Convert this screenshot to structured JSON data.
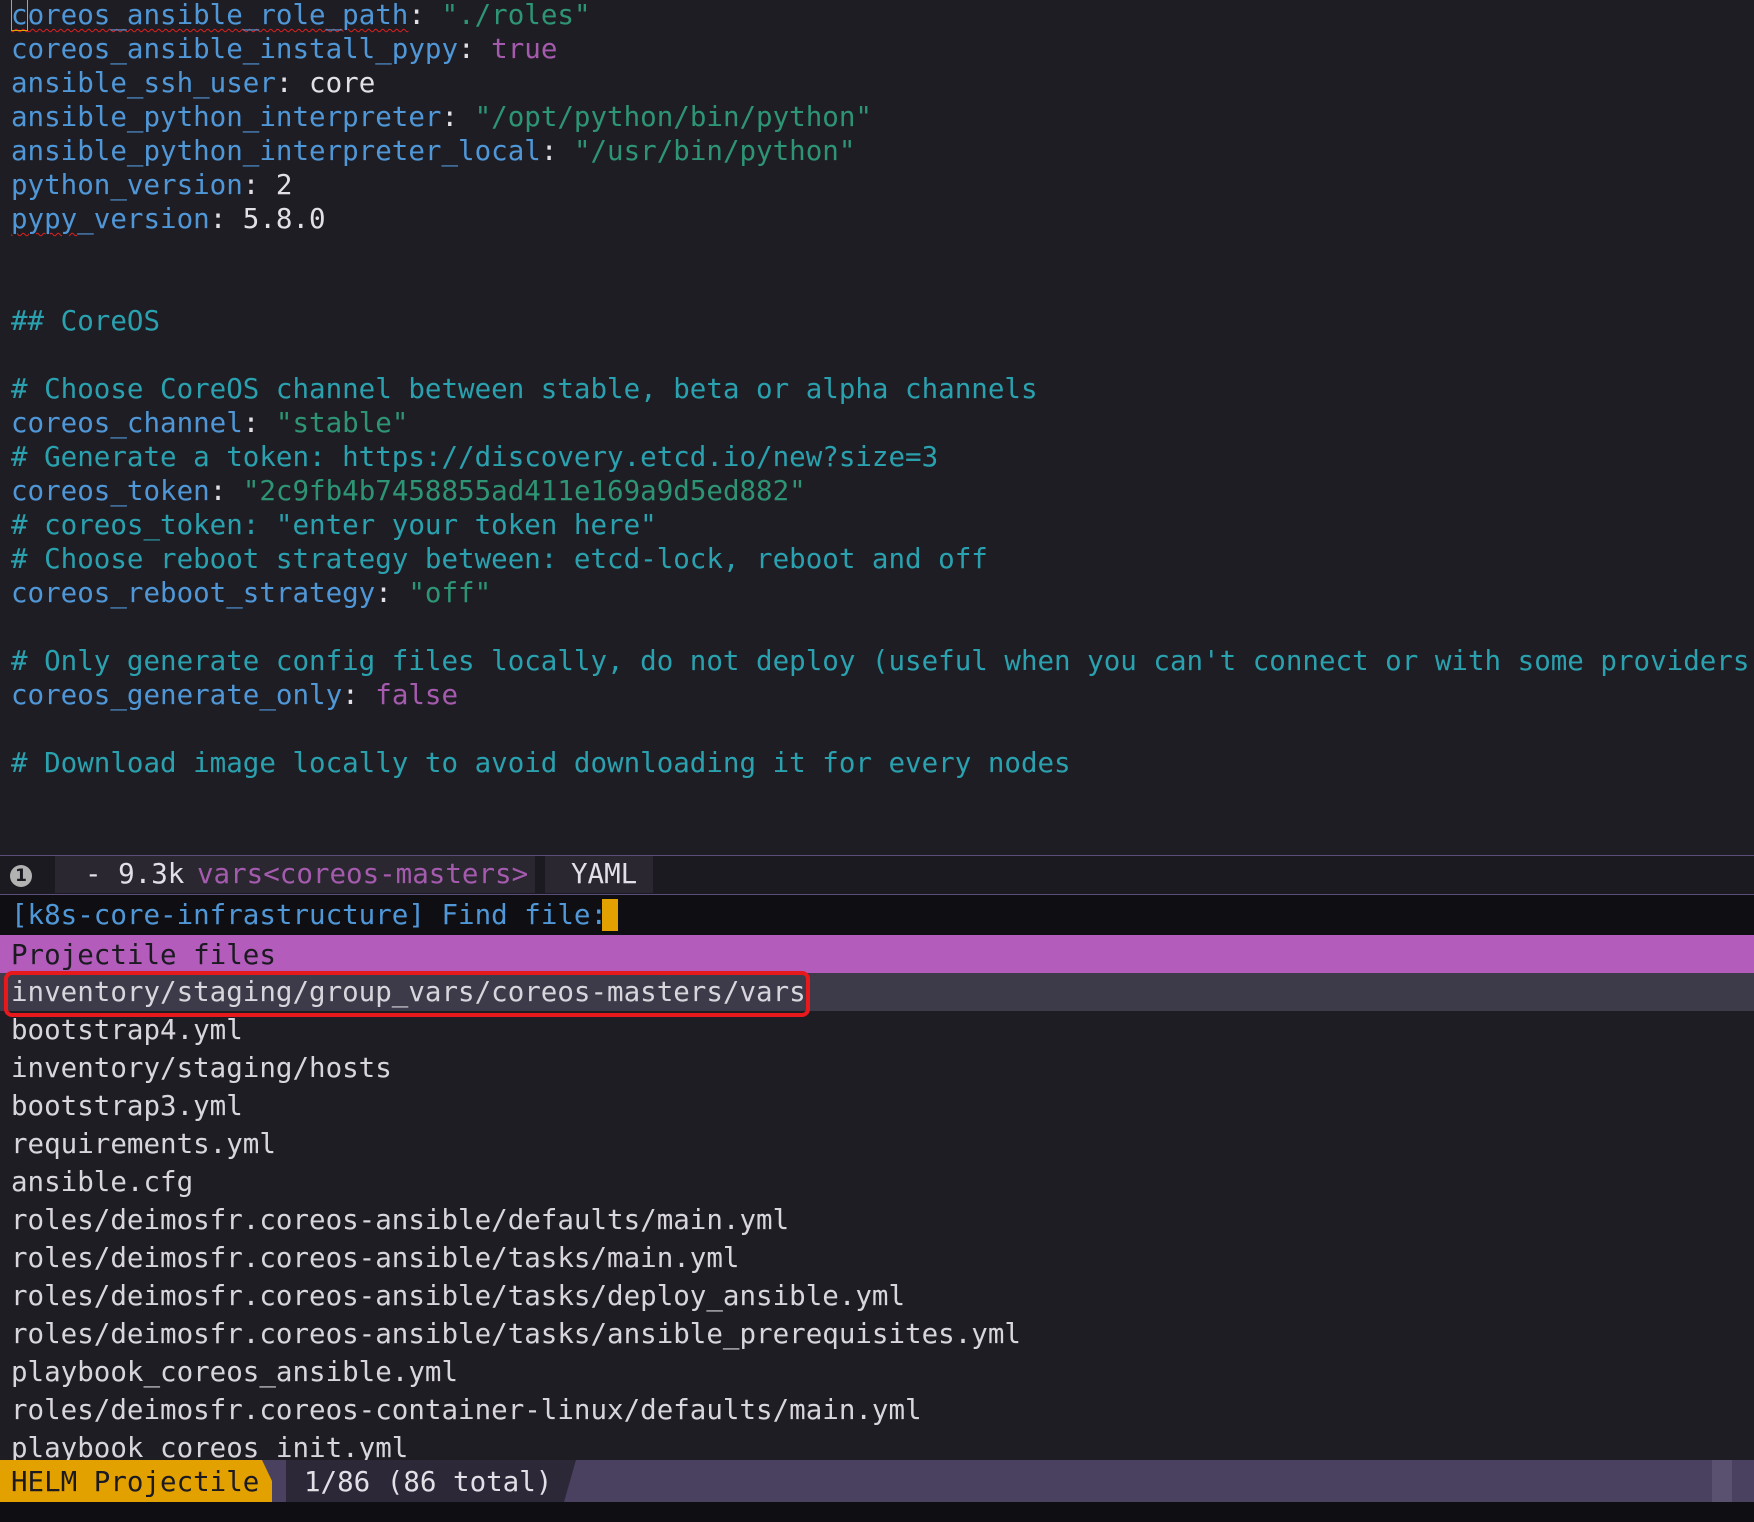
{
  "editor": {
    "lines": [
      [
        {
          "t": "coreos_ansible_role_path",
          "c": "key",
          "squiggle": true,
          "cursor_first": true
        },
        {
          "t": ": ",
          "c": "plain"
        },
        {
          "t": "\"./roles\"",
          "c": "str"
        }
      ],
      [
        {
          "t": "coreos_ansible_install_pypy",
          "c": "key"
        },
        {
          "t": ": ",
          "c": "plain"
        },
        {
          "t": "true",
          "c": "bool"
        }
      ],
      [
        {
          "t": "ansible_ssh_user",
          "c": "key"
        },
        {
          "t": ": core",
          "c": "plain"
        }
      ],
      [
        {
          "t": "ansible_python_interpreter",
          "c": "key"
        },
        {
          "t": ": ",
          "c": "plain"
        },
        {
          "t": "\"/opt/python/bin/python\"",
          "c": "str"
        }
      ],
      [
        {
          "t": "ansible_python_interpreter_local",
          "c": "key"
        },
        {
          "t": ": ",
          "c": "plain"
        },
        {
          "t": "\"/usr/bin/python\"",
          "c": "str"
        }
      ],
      [
        {
          "t": "python_version",
          "c": "key"
        },
        {
          "t": ": 2",
          "c": "plain"
        }
      ],
      [
        {
          "t": "pypy",
          "c": "key",
          "squiggle": true
        },
        {
          "t": "_version",
          "c": "key"
        },
        {
          "t": ": 5.8.0",
          "c": "plain"
        }
      ],
      [],
      [],
      [
        {
          "t": "## CoreOS",
          "c": "comment"
        }
      ],
      [],
      [
        {
          "t": "# Choose CoreOS channel between stable, beta or alpha channels",
          "c": "comment"
        }
      ],
      [
        {
          "t": "coreos_channel",
          "c": "key"
        },
        {
          "t": ": ",
          "c": "plain"
        },
        {
          "t": "\"stable\"",
          "c": "str"
        }
      ],
      [
        {
          "t": "# Generate a token: https://discovery.etcd.io/new?size=3",
          "c": "comment"
        }
      ],
      [
        {
          "t": "coreos_token",
          "c": "key"
        },
        {
          "t": ": ",
          "c": "plain"
        },
        {
          "t": "\"2c9fb4b7458855ad411e169a9d5ed882\"",
          "c": "str"
        }
      ],
      [
        {
          "t": "# coreos_token: \"enter your token here\"",
          "c": "comment"
        }
      ],
      [
        {
          "t": "# Choose reboot strategy between: etcd-lock, reboot and off",
          "c": "comment"
        }
      ],
      [
        {
          "t": "coreos_reboot_strategy",
          "c": "key"
        },
        {
          "t": ": ",
          "c": "plain"
        },
        {
          "t": "\"off\"",
          "c": "str"
        }
      ],
      [],
      [
        {
          "t": "# Only generate config files locally, do not deploy (useful when you can't connect or with some providers)",
          "c": "comment"
        }
      ],
      [
        {
          "t": "coreos_generate_only",
          "c": "key"
        },
        {
          "t": ": ",
          "c": "plain"
        },
        {
          "t": "false",
          "c": "bool"
        }
      ],
      [],
      [
        {
          "t": "# Download image locally to avoid downloading it for every nodes",
          "c": "comment"
        }
      ]
    ]
  },
  "modeline": {
    "window_number": "1",
    "status": "- 9.3k ",
    "buffer_name": "vars<coreos-masters>",
    "major_mode": "YAML"
  },
  "prompt": {
    "project": "[k8s-core-infrastructure]",
    "label": " Find file: "
  },
  "helm": {
    "source_header": "Projectile files",
    "candidates": [
      "inventory/staging/group_vars/coreos-masters/vars",
      "bootstrap4.yml",
      "inventory/staging/hosts",
      "bootstrap3.yml",
      "requirements.yml",
      "ansible.cfg",
      "roles/deimosfr.coreos-ansible/defaults/main.yml",
      "roles/deimosfr.coreos-ansible/tasks/main.yml",
      "roles/deimosfr.coreos-ansible/tasks/deploy_ansible.yml",
      "roles/deimosfr.coreos-ansible/tasks/ansible_prerequisites.yml",
      "playbook_coreos_ansible.yml",
      "roles/deimosfr.coreos-container-linux/defaults/main.yml",
      "playbook_coreos_init.yml"
    ],
    "selected_index": 0,
    "mode_name": "HELM Projectile",
    "count": "1/86 (86 total)"
  }
}
